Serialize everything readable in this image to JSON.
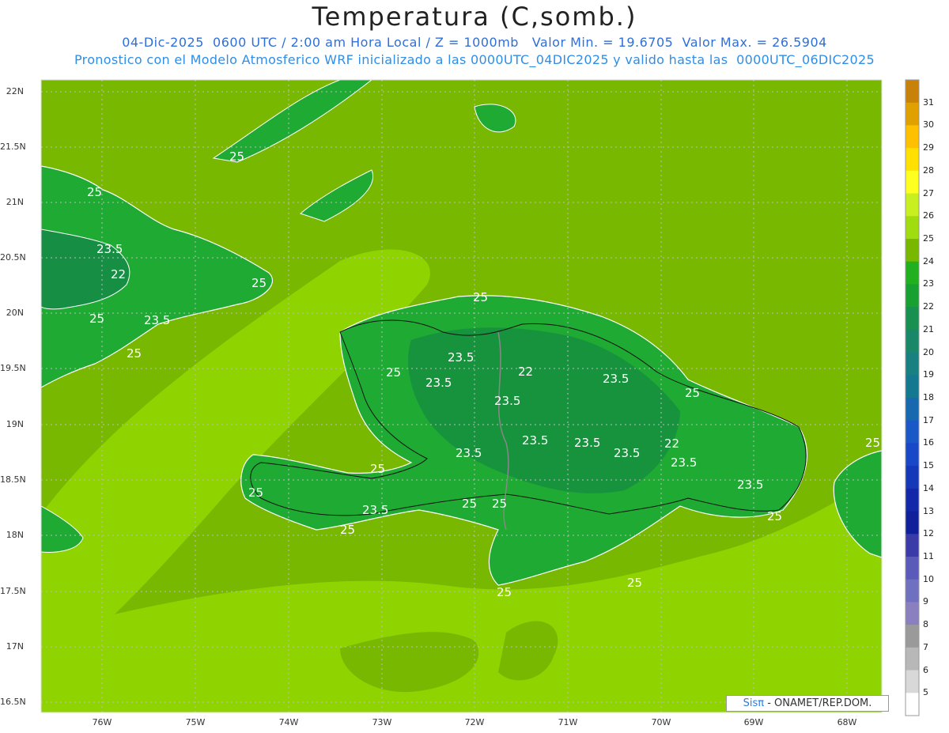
{
  "header": {
    "title": "Temperatura (C,somb.)",
    "line1": "04-Dic-2025  0600 UTC / 2:00 am Hora Local / Z = 1000mb   Valor Min. = 19.6705  Valor Max. = 26.5904",
    "line2": "Pronostico con el Modelo Atmosferico WRF inicializado a las 0000UTC_04DIC2025 y valido hasta las  0000UTC_06DIC2025"
  },
  "axes": {
    "lat_labels": [
      "22N",
      "21.5N",
      "21N",
      "20.5N",
      "20N",
      "19.5N",
      "19N",
      "18.5N",
      "18N",
      "17.5N",
      "17N",
      "16.5N"
    ],
    "lon_labels": [
      "76W",
      "75W",
      "74W",
      "73W",
      "72W",
      "71W",
      "70W",
      "69W",
      "68W"
    ]
  },
  "colorbar": {
    "labels": [
      "31",
      "30",
      "29",
      "28",
      "27",
      "26",
      "25",
      "24",
      "23",
      "22",
      "21",
      "20",
      "19",
      "18",
      "17",
      "16",
      "15",
      "14",
      "13",
      "12",
      "11",
      "10",
      "9",
      "8",
      "7",
      "6",
      "5"
    ],
    "colors": [
      "#c8820a",
      "#e0a000",
      "#ffc000",
      "#ffe000",
      "#ffff20",
      "#c8f020",
      "#a0dc10",
      "#78b800",
      "#20b020",
      "#18a030",
      "#189050",
      "#188868",
      "#188080",
      "#147890",
      "#1868b0",
      "#1a58c8",
      "#1848c8",
      "#1438b8",
      "#1228a8",
      "#10209a",
      "#3a3aa8",
      "#5a5ab8",
      "#7070c0",
      "#8a80c0",
      "#9a9a9a",
      "#b8b8b8",
      "#d8d8d8",
      "#ffffff"
    ]
  },
  "contour_labels": [
    "25",
    "25",
    "25",
    "25",
    "25",
    "25",
    "25",
    "25",
    "25",
    "25",
    "25",
    "25",
    "25",
    "25",
    "25",
    "25",
    "23.5",
    "23.5",
    "23.5",
    "23.5",
    "23.5",
    "23.5",
    "23.5",
    "23.5",
    "23.5",
    "23.5",
    "23.5",
    "23.5",
    "22",
    "22",
    "22"
  ],
  "credit": {
    "brand": "Sisπ",
    "text": " - ONAMET/REP.DOM."
  },
  "legend_colors": {
    "land_warm": "#1faa33",
    "land_cool": "#168f45",
    "sea_mid": "#78b800",
    "sea_warm": "#8fd400"
  }
}
